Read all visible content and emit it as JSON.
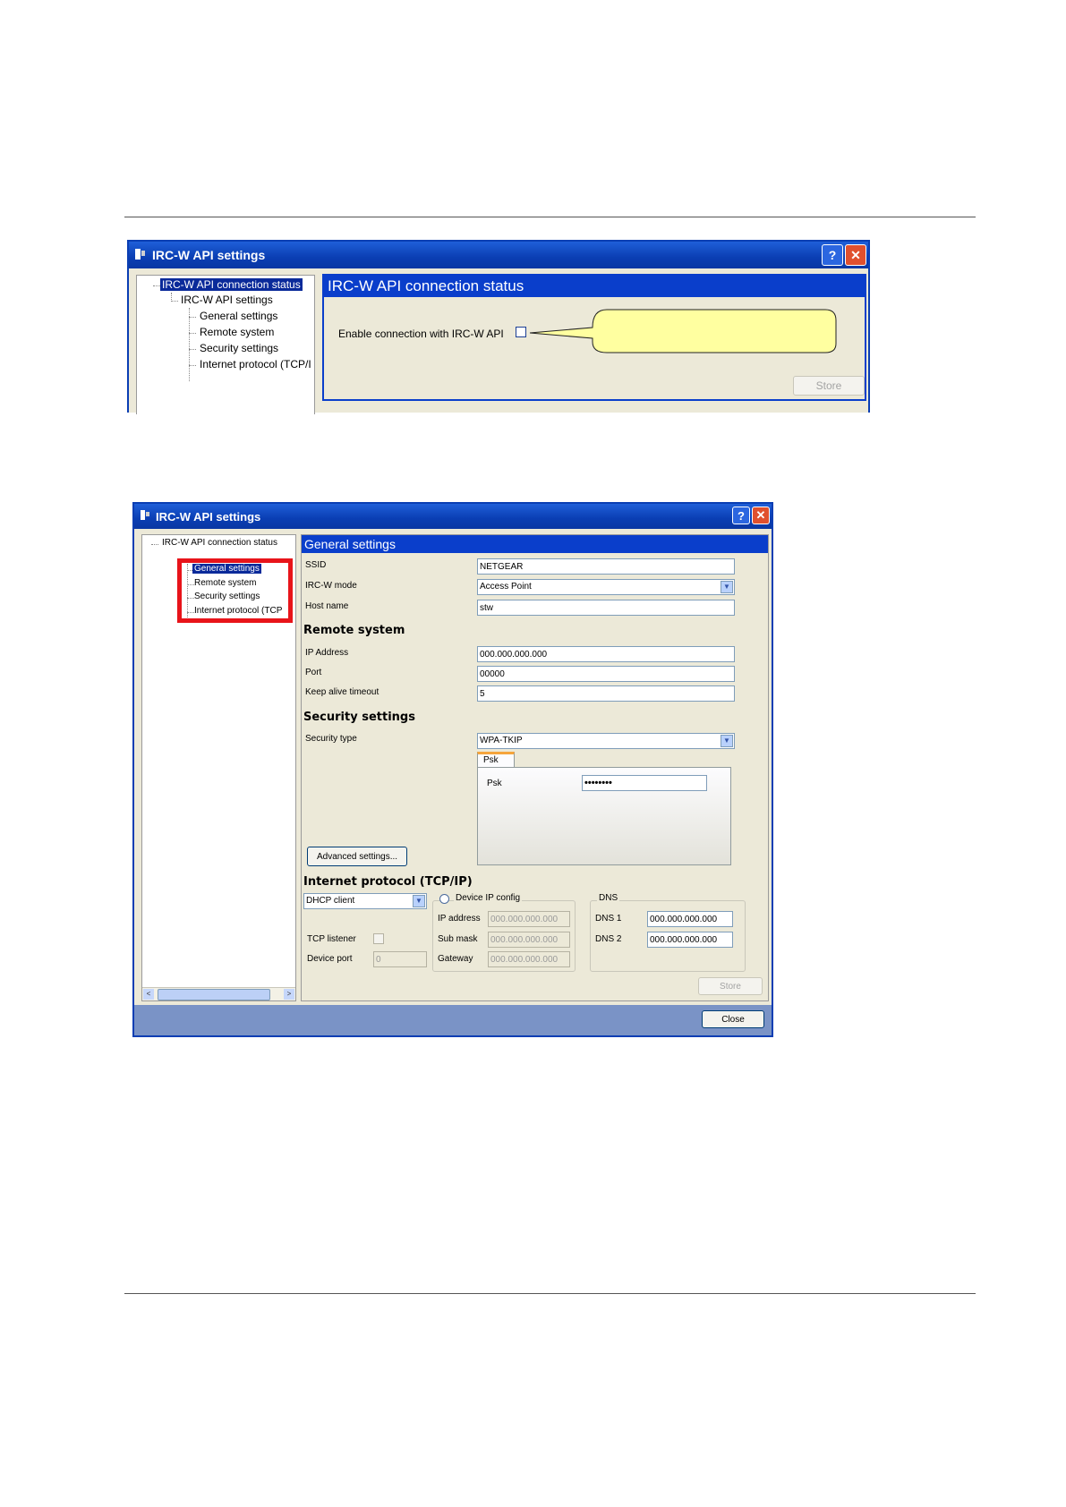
{
  "window1": {
    "title": "IRC-W API settings",
    "help_label": "?",
    "close_label": "✕",
    "tree": {
      "root": "IRC-W API connection status",
      "settings": "IRC-W API settings",
      "general": "General settings",
      "remote": "Remote system",
      "security": "Security settings",
      "internet": "Internet protocol (TCP/I"
    },
    "panel_title": "IRC-W API connection status",
    "enable_label": "Enable connection with IRC-W API",
    "store_label": "Store"
  },
  "window2": {
    "title": "IRC-W API settings",
    "help_label": "?",
    "close_label": "✕",
    "tree": {
      "root": "IRC-W API connection status",
      "general": "General settings",
      "remote": "Remote system",
      "security": "Security settings",
      "internet": "Internet protocol (TCP"
    },
    "general": {
      "title": "General settings",
      "ssid_label": "SSID",
      "ssid_value": "NETGEAR",
      "mode_label": "IRC-W mode",
      "mode_value": "Access Point",
      "host_label": "Host name",
      "host_value": "stw"
    },
    "remote": {
      "title": "Remote system",
      "ip_label": "IP Address",
      "ip_value": "000.000.000.000",
      "port_label": "Port",
      "port_value": "00000",
      "keepalive_label": "Keep alive timeout",
      "keepalive_value": "5"
    },
    "security": {
      "title": "Security settings",
      "type_label": "Security type",
      "type_value": "WPA-TKIP",
      "tab_label": "Psk",
      "psk_label": "Psk",
      "psk_value": "••••••••",
      "advanced_label": "Advanced settings..."
    },
    "internet": {
      "title": "Internet protocol (TCP/IP)",
      "dhcp_value": "DHCP client",
      "tcp_listener_label": "TCP listener",
      "device_port_label": "Device port",
      "device_port_value": "0",
      "device_ip_label": "Device IP config",
      "ip_label": "IP address",
      "ip_value": "000.000.000.000",
      "mask_label": "Sub mask",
      "mask_value": "000.000.000.000",
      "gateway_label": "Gateway",
      "gateway_value": "000.000.000.000",
      "dns_label": "DNS",
      "dns1_label": "DNS 1",
      "dns1_value": "000.000.000.000",
      "dns2_label": "DNS 2",
      "dns2_value": "000.000.000.000"
    },
    "store_label": "Store",
    "close_button_label": "Close"
  }
}
